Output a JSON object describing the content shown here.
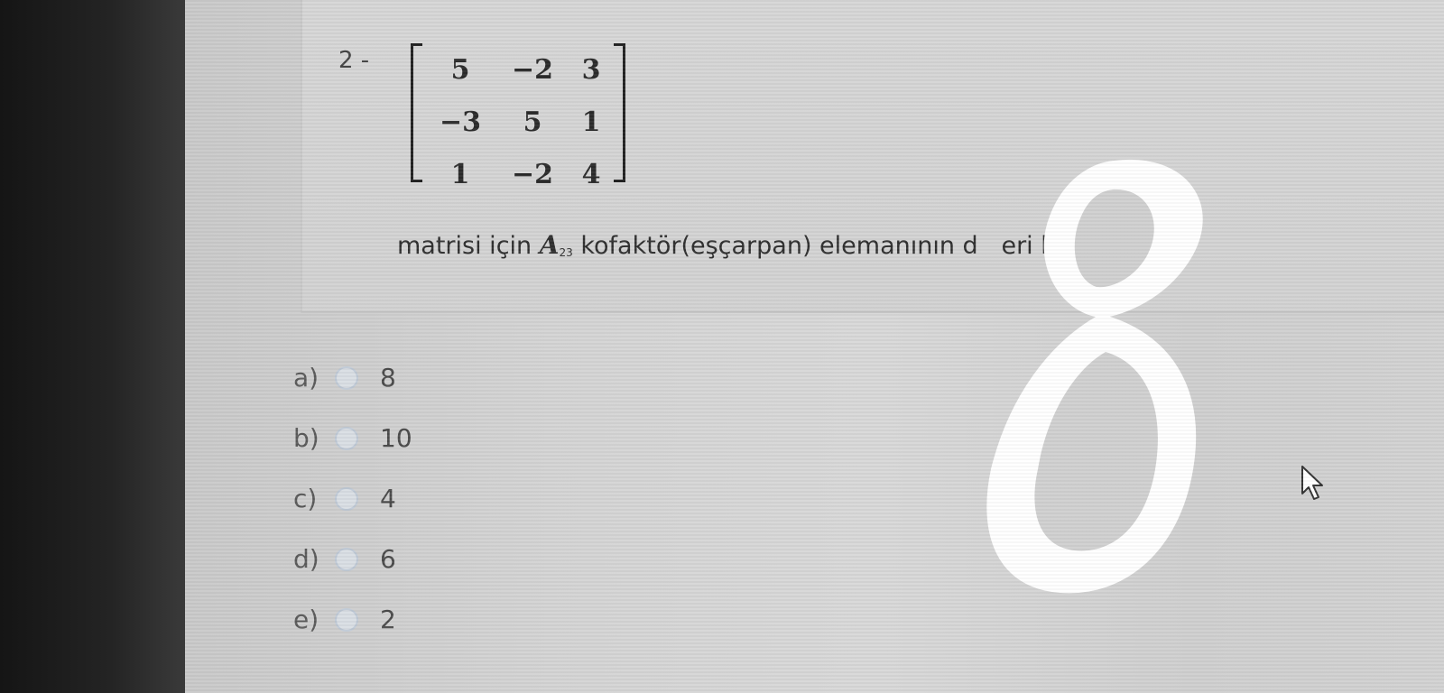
{
  "question": {
    "number": "2 -",
    "matrix": [
      [
        "5",
        "−2",
        "3"
      ],
      [
        "−3",
        "5",
        "1"
      ],
      [
        "1",
        "−2",
        "4"
      ]
    ],
    "text_before": "matrisi için",
    "variable": "A",
    "subscript": "23",
    "text_after": "kofaktör(eşçarpan) elemanının d",
    "text_tail": "eri kaçtı"
  },
  "options": [
    {
      "letter": "a)",
      "value": "8"
    },
    {
      "letter": "b)",
      "value": "10"
    },
    {
      "letter": "c)",
      "value": "4"
    },
    {
      "letter": "d)",
      "value": "6"
    },
    {
      "letter": "e)",
      "value": "2"
    }
  ],
  "handwritten_answer": "8",
  "colors": {
    "screen_bg": "#d2d2d2",
    "text": "#2e2e2e",
    "radio_border": "#bfc9d6",
    "overlay": "#ffffff"
  },
  "icons": {
    "cursor": "mouse-pointer-icon"
  }
}
